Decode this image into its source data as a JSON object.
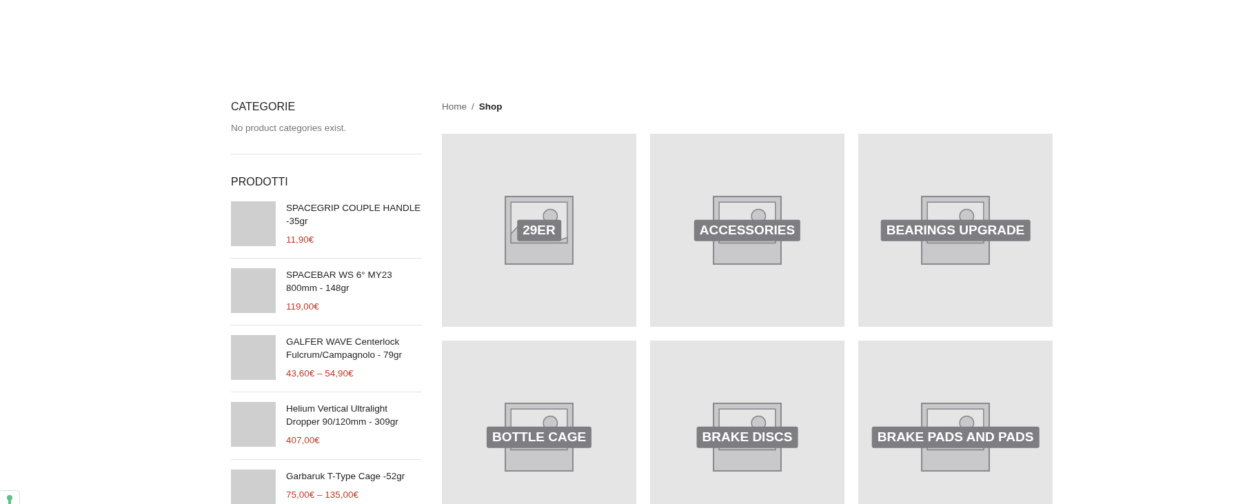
{
  "sidebar": {
    "categories": {
      "title": "CATEGORIE",
      "message": "No product categories exist."
    },
    "products": {
      "title": "PRODOTTI",
      "items": [
        {
          "name": "SPACEGRIP COUPLE HANDLE -35gr",
          "price": "11,90€"
        },
        {
          "name": "SPACEBAR WS 6° MY23 800mm - 148gr",
          "price": "119,00€"
        },
        {
          "name": "GALFER WAVE Centerlock Fulcrum/Campagnolo - 79gr",
          "price": "43,60€ – 54,90€"
        },
        {
          "name": "Helium Vertical Ultralight Dropper 90/120mm - 309gr",
          "price": "407,00€"
        },
        {
          "name": "Garbaruk T-Type Cage -52gr",
          "price": "75,00€ – 135,00€"
        }
      ]
    }
  },
  "breadcrumb": {
    "separator": "/",
    "items": [
      {
        "label": "Home",
        "selected": false
      },
      {
        "label": "Shop",
        "selected": true
      }
    ]
  },
  "categories": [
    {
      "label": "29ER"
    },
    {
      "label": "ACCESSORIES"
    },
    {
      "label": "BEARINGS UPGRADE"
    },
    {
      "label": "BOTTLE CAGE"
    },
    {
      "label": "BRAKE DISCS"
    },
    {
      "label": "BRAKE PADS AND PADS"
    }
  ]
}
